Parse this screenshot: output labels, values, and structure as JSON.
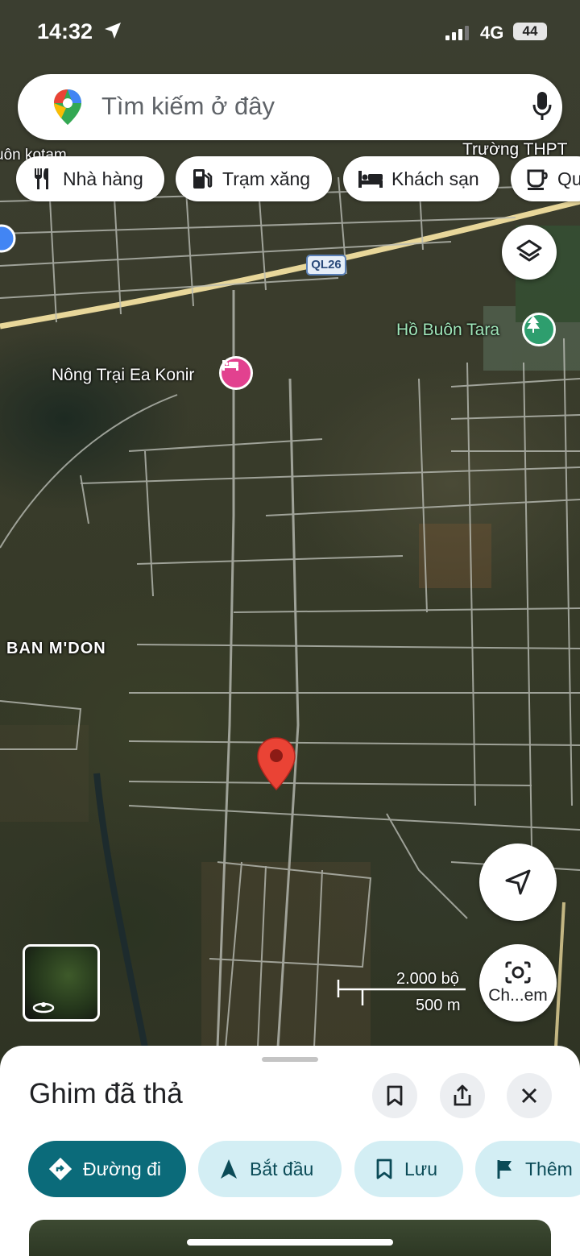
{
  "status_bar": {
    "time": "14:32",
    "network": "4G",
    "battery": "44"
  },
  "search": {
    "placeholder": "Tìm kiếm ở đây"
  },
  "chips": [
    {
      "label": "Nhà hàng",
      "icon": "restaurant-icon"
    },
    {
      "label": "Trạm xăng",
      "icon": "gas-station-icon"
    },
    {
      "label": "Khách sạn",
      "icon": "hotel-bed-icon"
    },
    {
      "label": "Qu",
      "icon": "coffee-cup-icon"
    }
  ],
  "map": {
    "labels": {
      "top_left": "uôn kotam",
      "school": "Trường THPT",
      "road": "QL26",
      "lake": "Hồ Buôn Tara",
      "farm": "Nông Trại Ea Konir",
      "area": "BAN M'DON"
    },
    "scale": {
      "imperial": "2.000 bộ",
      "metric": "500 m"
    },
    "camera_label": "Ch...em",
    "colors": {
      "road_highlight": "#e8d79a",
      "pin": "#ea4335",
      "hotel_pin": "#e2418f",
      "park_pin": "#2e9e6e"
    }
  },
  "sheet": {
    "title": "Ghim đã thả",
    "actions": [
      {
        "label": "Đường đi",
        "icon": "directions-icon"
      },
      {
        "label": "Bắt đầu",
        "icon": "navigation-arrow-icon"
      },
      {
        "label": "Lưu",
        "icon": "bookmark-icon"
      },
      {
        "label": "Thêm",
        "icon": "flag-icon"
      }
    ]
  }
}
